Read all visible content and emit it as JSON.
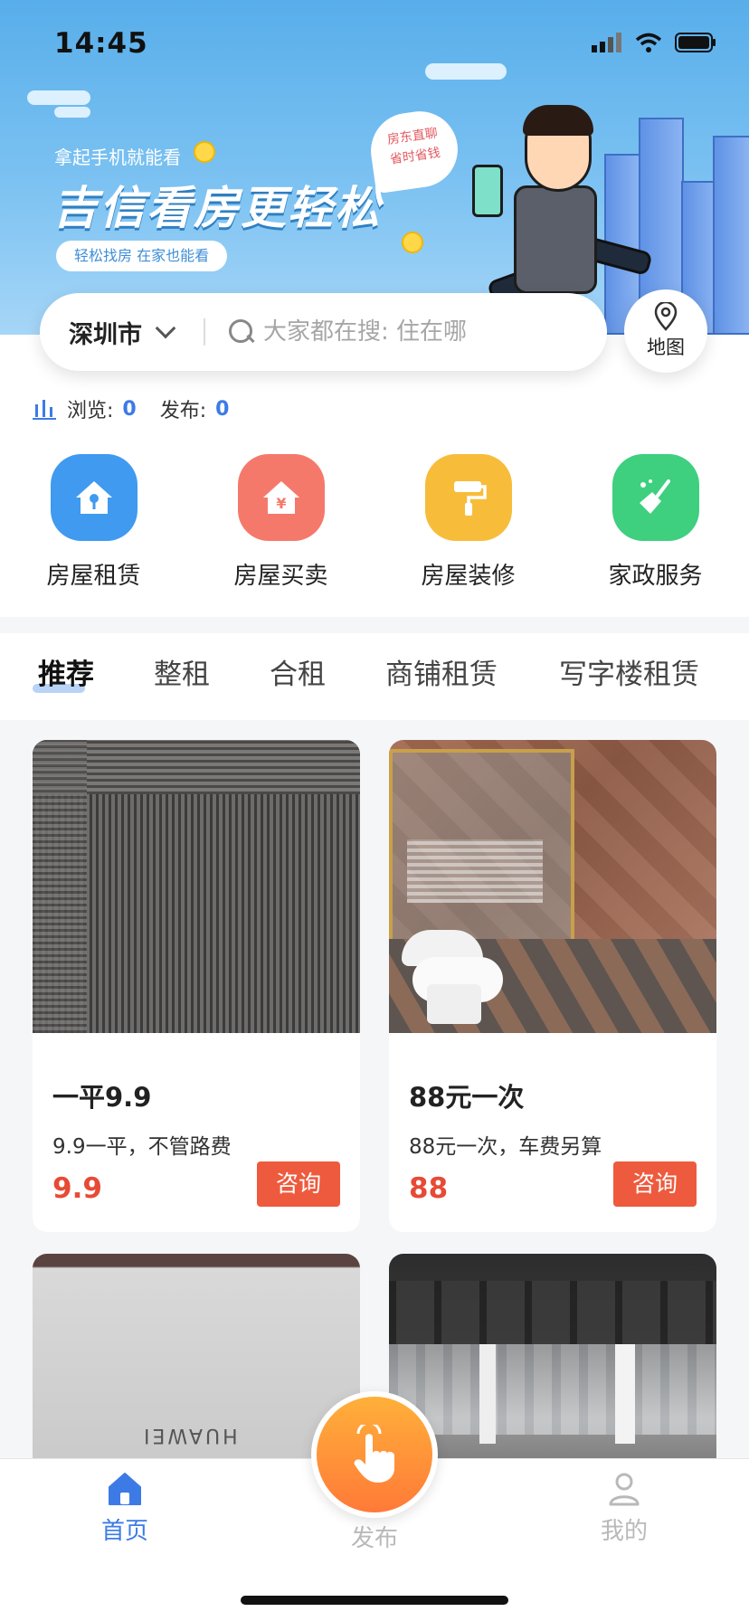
{
  "status_bar": {
    "time": "14:45"
  },
  "banner": {
    "small_text": "拿起手机就能看",
    "title": "吉信看房更轻松",
    "pill": "轻松找房 在家也能看",
    "bubble_line1": "房东直聊",
    "bubble_line2": "省时省钱"
  },
  "search": {
    "city": "深圳市",
    "placeholder": "大家都在搜: 住在哪"
  },
  "map_button": {
    "label": "地图"
  },
  "stats": {
    "browse_label": "浏览:",
    "browse_count": "0",
    "publish_label": "发布:",
    "publish_count": "0"
  },
  "categories": [
    {
      "label": "房屋租赁",
      "icon": "house-key-icon",
      "color": "#3f9af0"
    },
    {
      "label": "房屋买卖",
      "icon": "house-yen-icon",
      "color": "#f5796a"
    },
    {
      "label": "房屋装修",
      "icon": "paint-roller-icon",
      "color": "#f7bd3a"
    },
    {
      "label": "家政服务",
      "icon": "broom-icon",
      "color": "#3ecf7f"
    }
  ],
  "tabs": [
    {
      "label": "推荐",
      "active": true
    },
    {
      "label": "整租"
    },
    {
      "label": "合租"
    },
    {
      "label": "商铺租赁"
    },
    {
      "label": "写字楼租赁"
    }
  ],
  "listings": [
    {
      "title": "一平9.9",
      "desc": "9.9一平，不管路费",
      "price": "9.9",
      "button": "咨询"
    },
    {
      "title": "88元一次",
      "desc": "88元一次，车费另算",
      "price": "88",
      "button": "咨询"
    },
    {
      "title": "",
      "desc": "",
      "price": "",
      "button": "",
      "image_text": "HUAWEI"
    },
    {
      "title": "",
      "desc": "",
      "price": "",
      "button": ""
    }
  ],
  "tabbar": [
    {
      "label": "首页",
      "icon": "home-icon",
      "active": true
    },
    {
      "label": "发布",
      "icon": "tap-hand-icon"
    },
    {
      "label": "我的",
      "icon": "person-icon"
    }
  ],
  "colors": {
    "accent": "#3c7be6",
    "price": "#e74a35",
    "button": "#ee5a3d",
    "inactive": "#b9b9b9"
  }
}
